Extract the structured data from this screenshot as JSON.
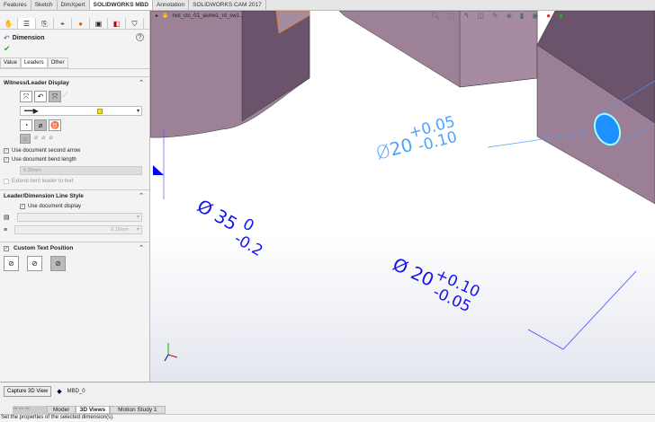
{
  "tabs": [
    "Features",
    "Sketch",
    "DimXpert",
    "SOLIDWORKS MBD",
    "Annotation",
    "SOLIDWORKS CAM 2017"
  ],
  "tree_node": "nist_ctc_01_asme1_rd_sw1...",
  "panel": {
    "title": "Dimension",
    "subtabs": [
      "Value",
      "Leaders",
      "Other"
    ],
    "witness": {
      "title": "Witness/Leader Display",
      "second_arrow": "Use document second arrow",
      "bend_length": "Use document bend length",
      "bend_value": "6.35mm",
      "extend": "Extend bent leader to text"
    },
    "style": {
      "title": "Leader/Dimension Line Style",
      "use_doc": "Use document display",
      "thickness": "0.18mm"
    },
    "custom": {
      "title": "Custom Text Position"
    }
  },
  "dims": [
    {
      "sym": "Ø",
      "nom": "20",
      "up": "+0.05",
      "lo": "-0.10"
    },
    {
      "sym": "Ø",
      "nom": "35",
      "up": "0",
      "lo": "-0.2"
    },
    {
      "sym": "Ø",
      "nom": "20",
      "up": "+0.10",
      "lo": "-0.05"
    }
  ],
  "bottom": {
    "capture": "Capture 3D View",
    "view": "MBD_0",
    "tabs": [
      "Model",
      "3D Views",
      "Motion Study 1"
    ],
    "status": "Set the properties of the selected dimension(s)."
  }
}
